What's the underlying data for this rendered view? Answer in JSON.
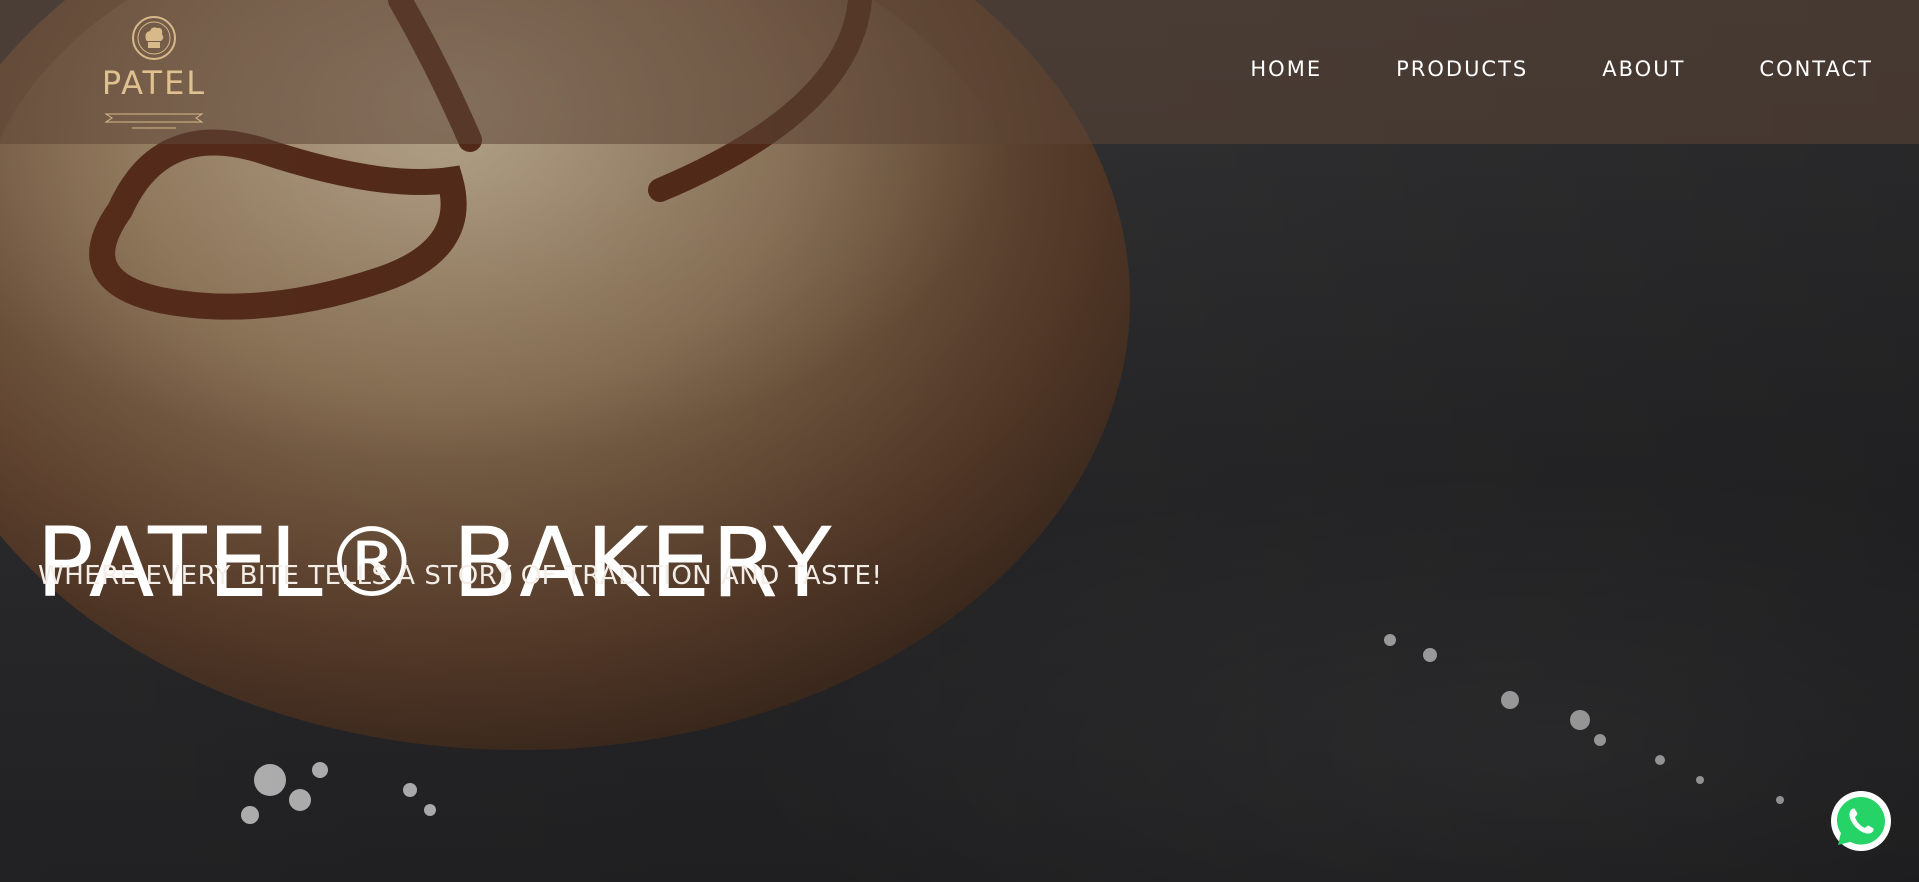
{
  "brand": {
    "logo_text": "PATEL",
    "accent_color": "#d8b98a"
  },
  "nav": {
    "items": [
      {
        "label": "HOME"
      },
      {
        "label": "PRODUCTS"
      },
      {
        "label": "ABOUT"
      },
      {
        "label": "CONTACT"
      }
    ]
  },
  "hero": {
    "title": "PATEL® BAKERY",
    "tagline": "WHERE EVERY BITE TELLS A STORY OF TRADITION AND TASTE!",
    "background_image": "dark-bread-loaf"
  },
  "floating": {
    "whatsapp_icon": "whatsapp-icon",
    "whatsapp_color": "#25d366"
  }
}
